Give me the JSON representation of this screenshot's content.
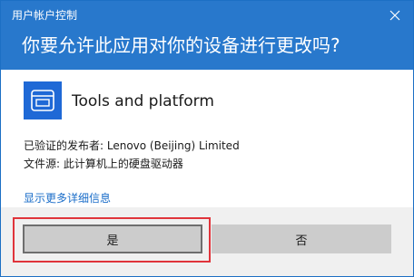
{
  "window": {
    "title": "用户帐户控制",
    "close_icon": "close-icon"
  },
  "header": {
    "question": "你要允许此应用对你的设备进行更改吗?"
  },
  "app": {
    "icon": "app-window-icon",
    "name": "Tools and platform"
  },
  "info": {
    "publisher": "已验证的发布者: Lenovo (Beijing) Limited",
    "source": "文件源: 此计算机上的硬盘驱动器"
  },
  "details_link": "显示更多详细信息",
  "buttons": {
    "yes_label": "是",
    "no_label": "否"
  },
  "colors": {
    "header_bg": "#2878cc",
    "app_icon_bg": "#1f69d6",
    "link": "#1a6dc9",
    "highlight": "#e0343b"
  }
}
